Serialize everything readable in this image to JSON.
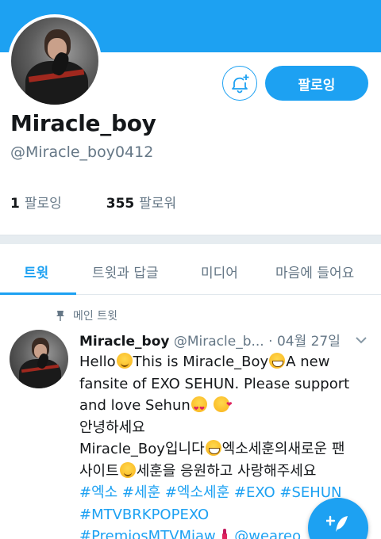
{
  "colors": {
    "accent": "#1da1f2",
    "text": "#14171a",
    "muted": "#657786",
    "divider": "#e6ecf0"
  },
  "profile": {
    "display_name": "Miracle_boy",
    "handle": "@Miracle_boy0412",
    "follow_button_label": "팔로잉",
    "notify_icon": "bell-plus-icon",
    "stats": [
      {
        "count": "1",
        "label": "팔로잉"
      },
      {
        "count": "355",
        "label": "팔로워"
      }
    ]
  },
  "tabs": [
    {
      "label": "트윗",
      "active": true
    },
    {
      "label": "트윗과 답글",
      "active": false
    },
    {
      "label": "미디어",
      "active": false
    },
    {
      "label": "마음에 들어요",
      "active": false
    }
  ],
  "pinned_label": "메인 트윗",
  "tweet": {
    "name": "Miracle_boy",
    "handle": "@Miracle_b...",
    "separator": "·",
    "date": "04월 27일",
    "body": {
      "l1_a": "Hello",
      "l1_b": "This is Miracle_Boy",
      "l1_c": "A new",
      "l2": "fansite of EXO SEHUN. Please support",
      "l3": "and love Sehun",
      "l4": "안녕하세요",
      "l5_a": "Miracle_Boy입니다",
      "l5_b": "엑소세훈의새로운 팬",
      "l6_a": "사이트",
      "l6_b": "세훈을 응원하고 사랑해주세요",
      "l7": "#엑소 #세훈 #엑소세훈 #EXO #SEHUN",
      "l8": "#MTVBRKPOPEXO",
      "l9_a": "#PremiosMTVMiaw",
      "l9_b": "@weareo"
    }
  },
  "fab_icon": "compose-feather-icon"
}
